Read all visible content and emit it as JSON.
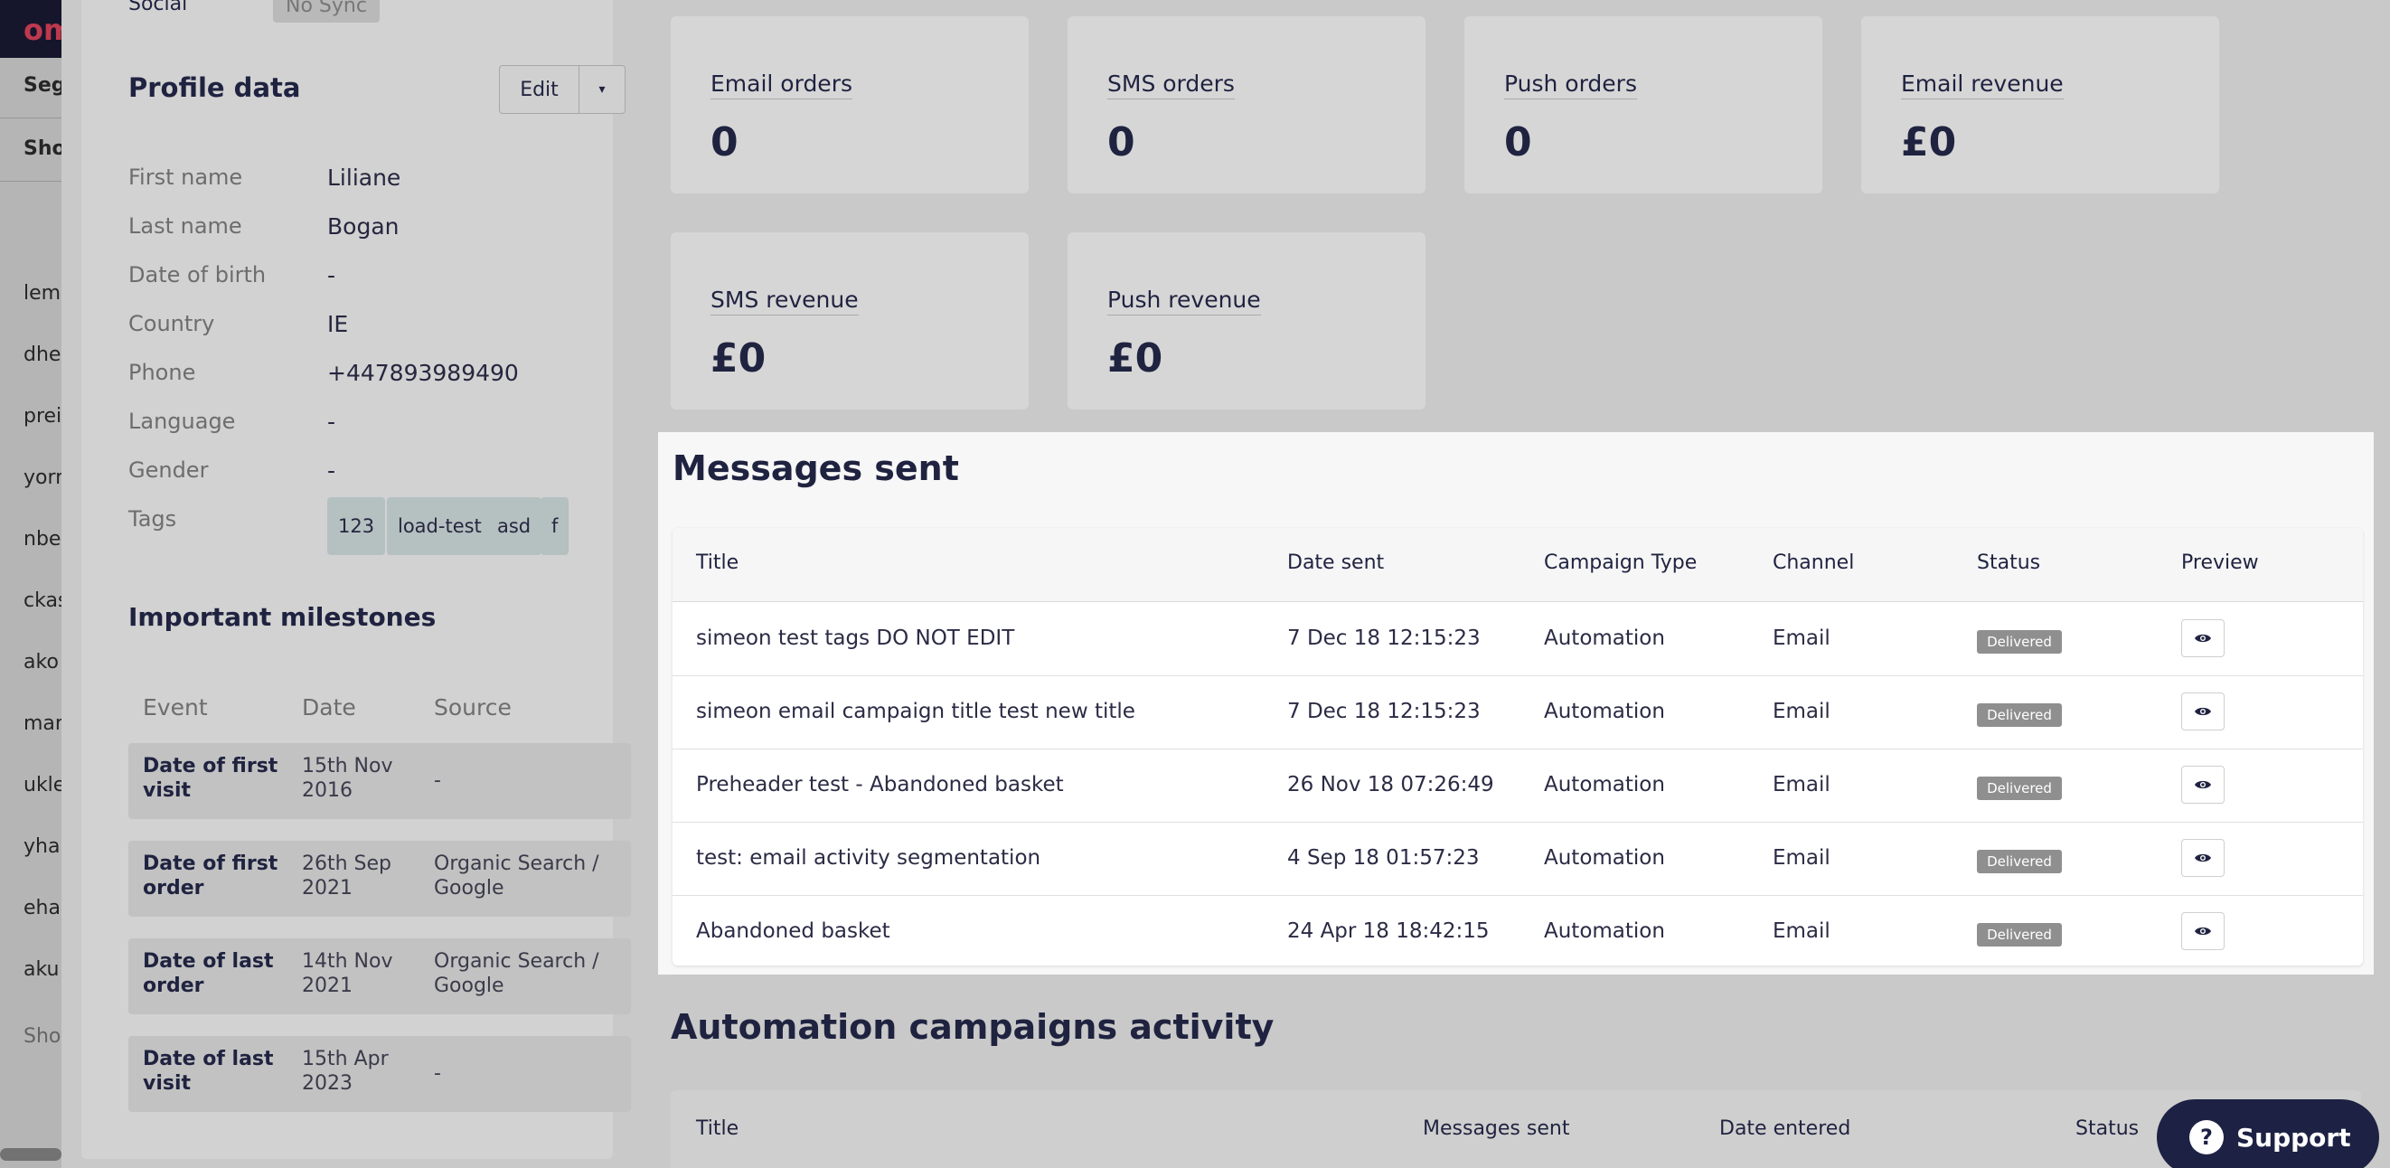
{
  "background": {
    "logo": "om",
    "rows": [
      "Seg",
      "Sho",
      "lem",
      "dhe",
      "prei",
      "yorr",
      "nbe",
      "ckas",
      "ako",
      "mar",
      "ukle",
      "yha",
      "eha",
      "aku",
      "Sho"
    ]
  },
  "profile": {
    "social_label": "Social",
    "social_badge": "No Sync",
    "title": "Profile data",
    "edit_label": "Edit",
    "fields": [
      {
        "label": "First name",
        "value": "Liliane"
      },
      {
        "label": "Last name",
        "value": "Bogan"
      },
      {
        "label": "Date of birth",
        "value": "-"
      },
      {
        "label": "Country",
        "value": "IE"
      },
      {
        "label": "Phone",
        "value": "+447893989490"
      },
      {
        "label": "Language",
        "value": "-"
      },
      {
        "label": "Gender",
        "value": "-"
      }
    ],
    "tags_label": "Tags",
    "tags": [
      "123",
      "load-test",
      "asd",
      "f"
    ]
  },
  "milestones": {
    "title": "Important milestones",
    "columns": [
      "Event",
      "Date",
      "Source"
    ],
    "rows": [
      {
        "event": "Date of first visit",
        "date": "15th Nov 2016",
        "source": "-"
      },
      {
        "event": "Date of first order",
        "date": "26th Sep 2021",
        "source": "Organic Search / Google"
      },
      {
        "event": "Date of last order",
        "date": "14th Nov 2021",
        "source": "Organic Search / Google"
      },
      {
        "event": "Date of last visit",
        "date": "15th Apr 2023",
        "source": "-"
      }
    ]
  },
  "stats": [
    {
      "label": "Email orders",
      "value": "0"
    },
    {
      "label": "SMS orders",
      "value": "0"
    },
    {
      "label": "Push orders",
      "value": "0"
    },
    {
      "label": "Email revenue",
      "value": "£0"
    },
    {
      "label": "SMS revenue",
      "value": "£0"
    },
    {
      "label": "Push revenue",
      "value": "£0"
    }
  ],
  "messages": {
    "title": "Messages sent",
    "columns": [
      "Title",
      "Date sent",
      "Campaign Type",
      "Channel",
      "Status",
      "Preview"
    ],
    "rows": [
      {
        "title": "simeon test tags DO NOT EDIT",
        "date": "7 Dec 18 12:15:23",
        "type": "Automation",
        "channel": "Email",
        "status": "Delivered"
      },
      {
        "title": "simeon email campaign title test new title",
        "date": "7 Dec 18 12:15:23",
        "type": "Automation",
        "channel": "Email",
        "status": "Delivered"
      },
      {
        "title": "Preheader test - Abandoned basket",
        "date": "26 Nov 18 07:26:49",
        "type": "Automation",
        "channel": "Email",
        "status": "Delivered"
      },
      {
        "title": "test: email activity segmentation",
        "date": "4 Sep 18 01:57:23",
        "type": "Automation",
        "channel": "Email",
        "status": "Delivered"
      },
      {
        "title": "Abandoned basket",
        "date": "24 Apr 18 18:42:15",
        "type": "Automation",
        "channel": "Email",
        "status": "Delivered"
      }
    ]
  },
  "automation": {
    "title": "Automation campaigns activity",
    "columns": [
      "Title",
      "Messages sent",
      "Date entered",
      "Status"
    ]
  },
  "support": {
    "label": "Support",
    "icon": "question-icon"
  }
}
